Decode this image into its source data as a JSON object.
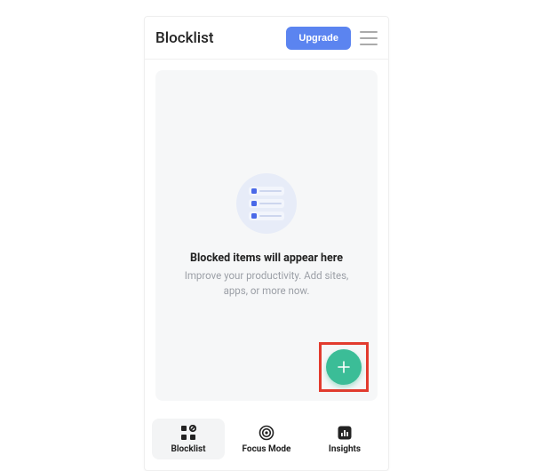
{
  "header": {
    "title": "Blocklist",
    "upgrade_label": "Upgrade"
  },
  "empty": {
    "title": "Blocked items will appear here",
    "subtitle": "Improve your productivity. Add sites, apps, or more now."
  },
  "nav": {
    "items": [
      {
        "label": "Blocklist"
      },
      {
        "label": "Focus Mode"
      },
      {
        "label": "Insights"
      }
    ]
  }
}
